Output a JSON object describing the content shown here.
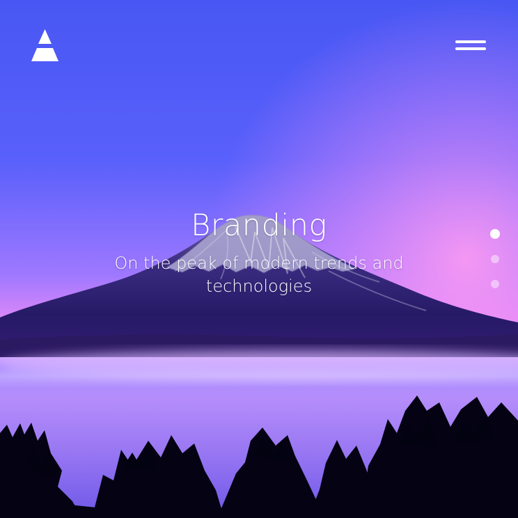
{
  "header": {
    "logo_icon": "triangle-logo-icon",
    "menu_icon": "hamburger-menu-icon"
  },
  "hero": {
    "title": "Branding",
    "subtitle": "On the peak of modern trends and technologies",
    "background": "mountain-lake-forest-image"
  },
  "pagination": {
    "dot_count": 3,
    "active_index": 0
  },
  "colors": {
    "sky_top": "#4857f3",
    "sky_pink": "#f78ef0",
    "mountain": "#2b1a6b",
    "lake": "#b98cf7",
    "trees": "#050313",
    "text": "#ffffff"
  }
}
